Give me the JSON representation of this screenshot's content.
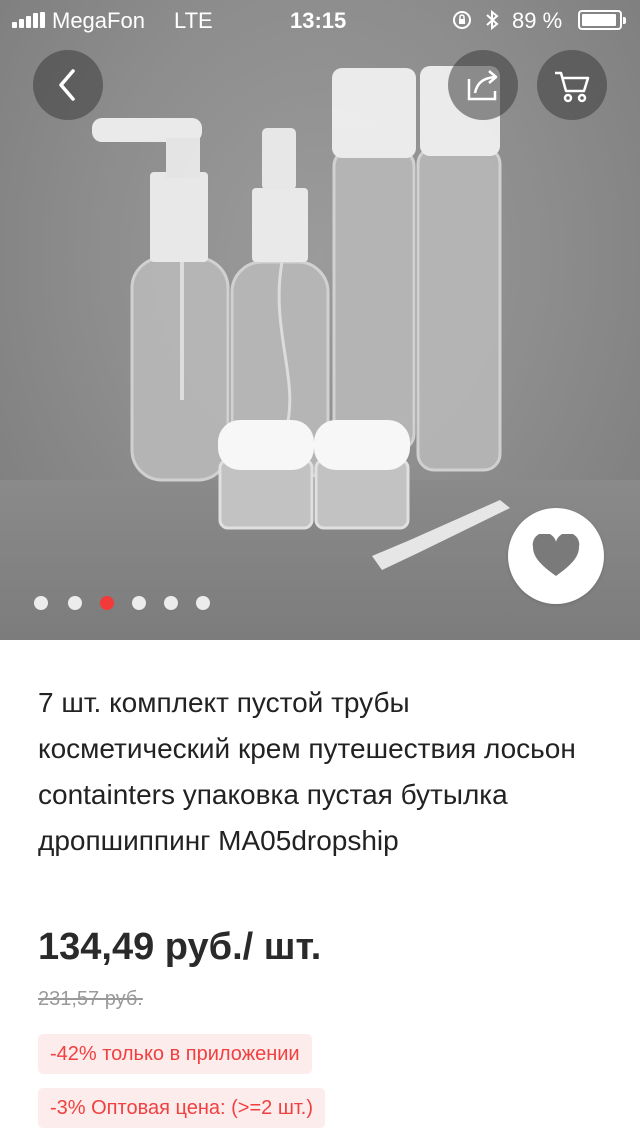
{
  "status_bar": {
    "carrier": "MegaFon",
    "network": "LTE",
    "time": "13:15",
    "battery": "89 %"
  },
  "hero": {
    "image_description_icon": "product-photo",
    "active_slide": 3,
    "slide_count": 6,
    "accent_color": "#f23a3a"
  },
  "icons": {
    "back": "chevron-left-icon",
    "share": "share-icon",
    "cart": "cart-icon",
    "favorite": "heart-icon"
  },
  "product": {
    "title": "7 шт. комплект пустой трубы косметический крем путешествия лосьон containters упаковка пустая бутылка дропшиппинг MA05dropship",
    "price": "134,49 руб./ шт.",
    "old_price": "231,57 руб.",
    "discounts": [
      "-42% только в приложении",
      "-3% Оптовая цена: (>=2 шт.)"
    ]
  }
}
